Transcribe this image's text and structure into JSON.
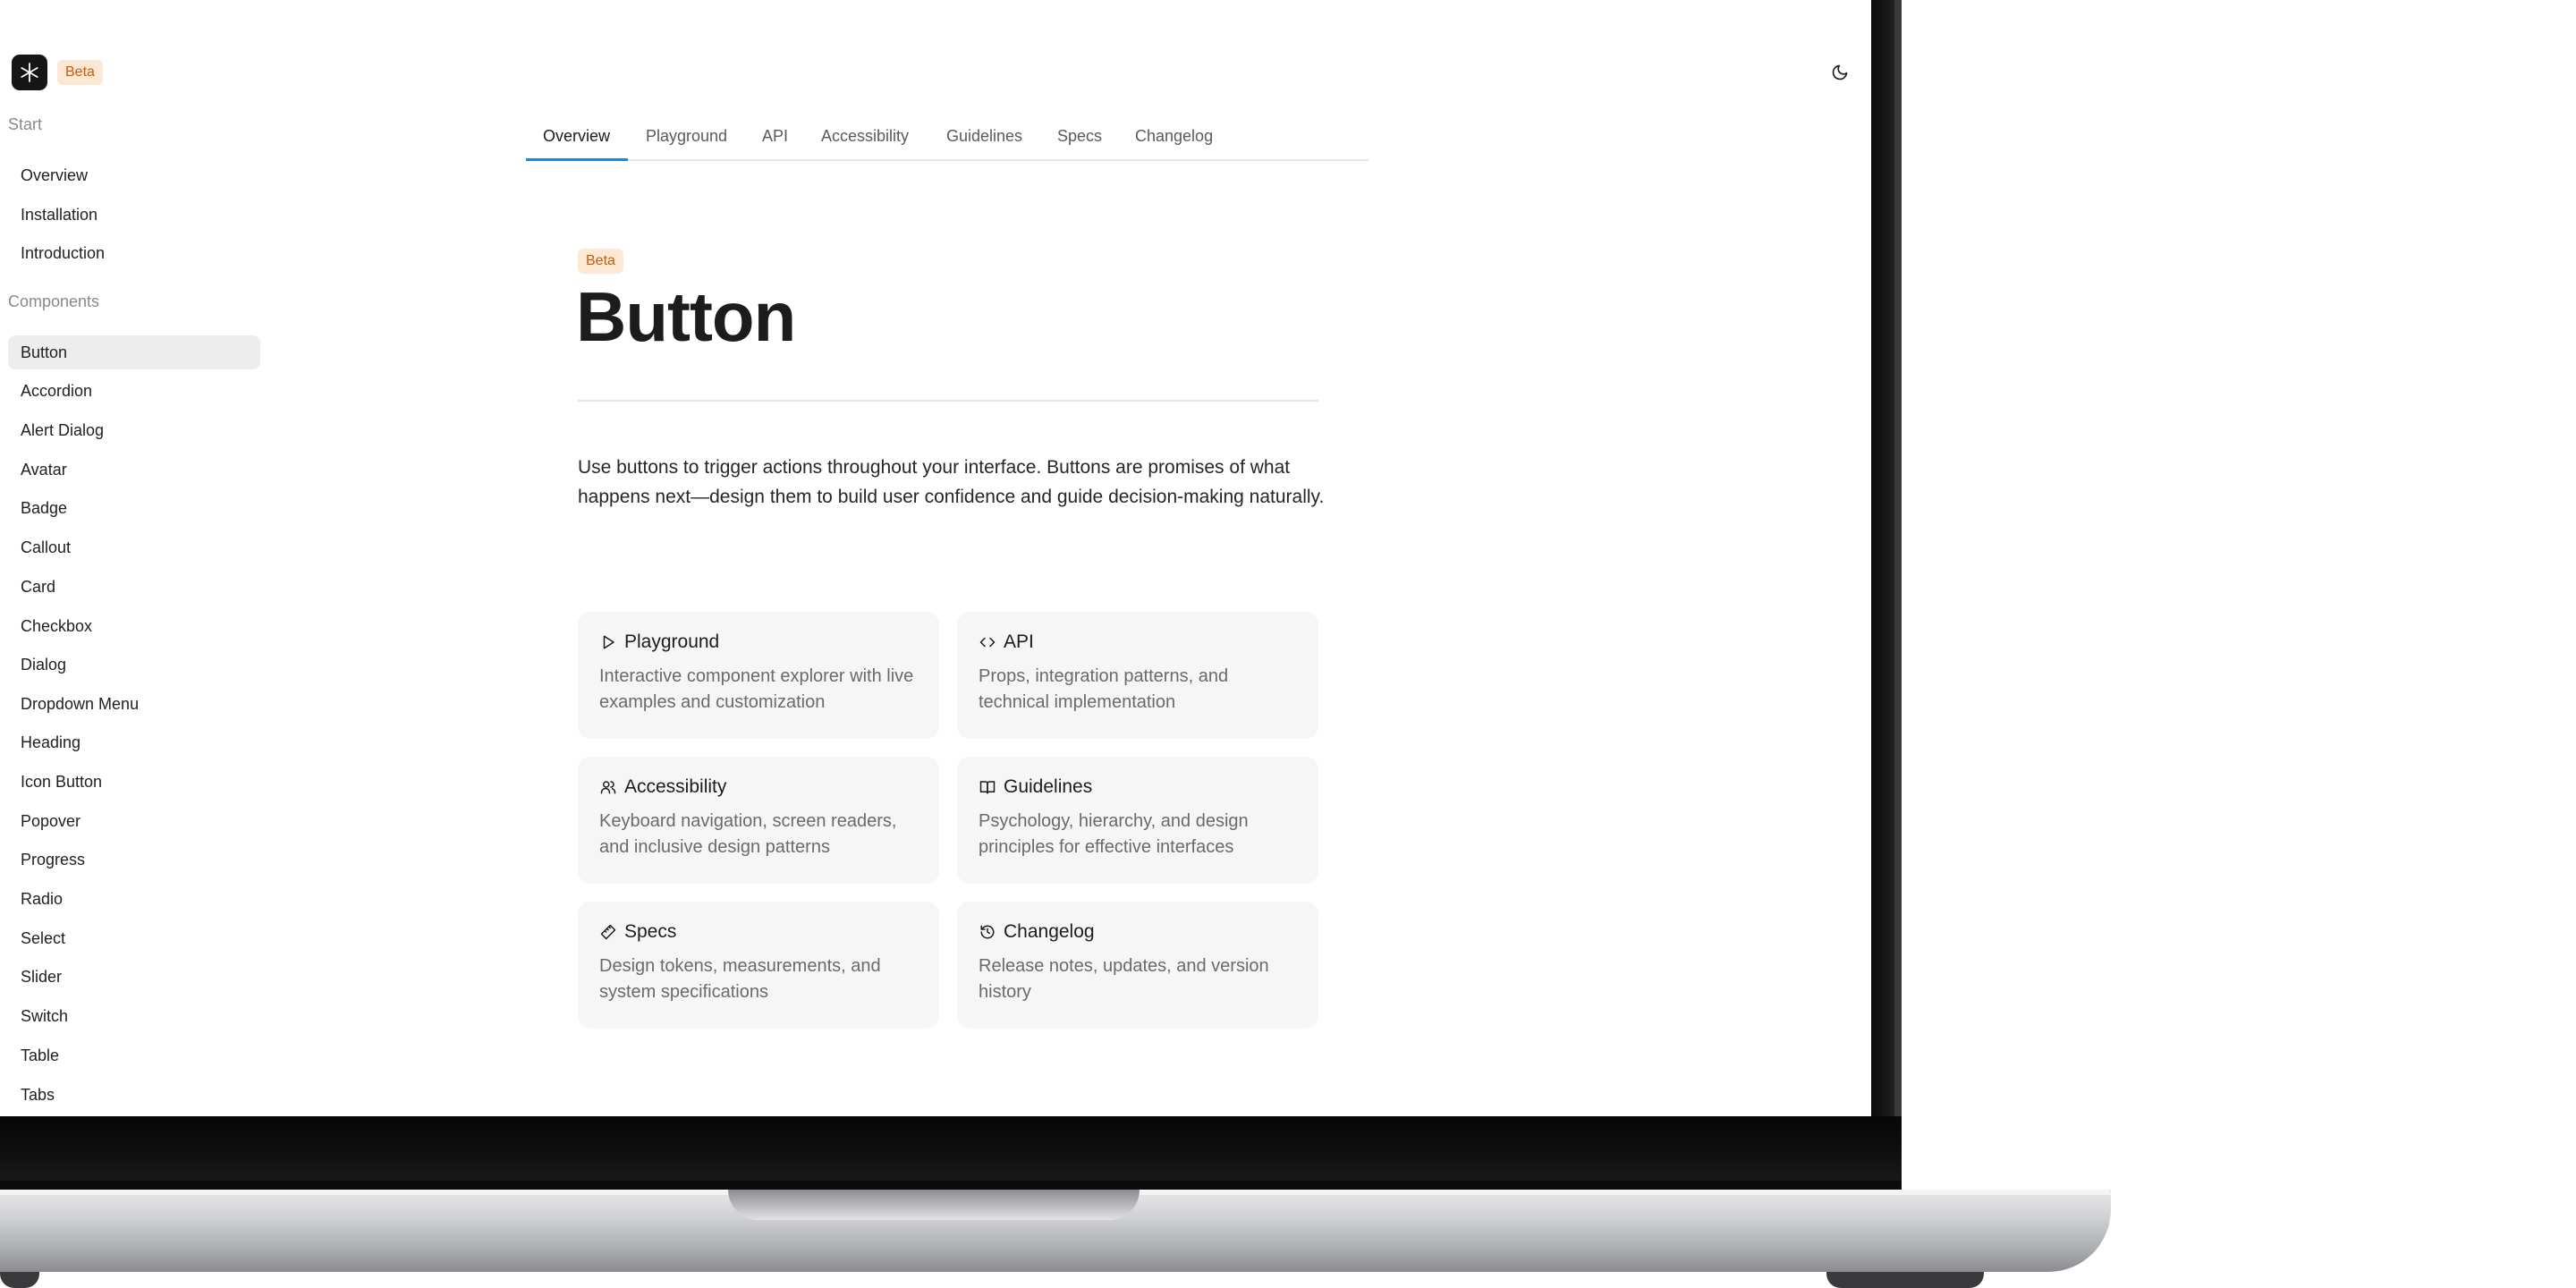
{
  "header": {
    "beta_badge": "Beta",
    "logo_icon": "asterisk-logo-icon",
    "theme_toggle_icon": "moon-icon"
  },
  "sidebar": {
    "sections": [
      {
        "label": "Start",
        "items": [
          {
            "label": "Overview",
            "active": false
          },
          {
            "label": "Installation",
            "active": false
          },
          {
            "label": "Introduction",
            "active": false
          }
        ]
      },
      {
        "label": "Components",
        "items": [
          {
            "label": "Button",
            "active": true
          },
          {
            "label": "Accordion",
            "active": false
          },
          {
            "label": "Alert Dialog",
            "active": false
          },
          {
            "label": "Avatar",
            "active": false
          },
          {
            "label": "Badge",
            "active": false
          },
          {
            "label": "Callout",
            "active": false
          },
          {
            "label": "Card",
            "active": false
          },
          {
            "label": "Checkbox",
            "active": false
          },
          {
            "label": "Dialog",
            "active": false
          },
          {
            "label": "Dropdown Menu",
            "active": false
          },
          {
            "label": "Heading",
            "active": false
          },
          {
            "label": "Icon Button",
            "active": false
          },
          {
            "label": "Popover",
            "active": false
          },
          {
            "label": "Progress",
            "active": false
          },
          {
            "label": "Radio",
            "active": false
          },
          {
            "label": "Select",
            "active": false
          },
          {
            "label": "Slider",
            "active": false
          },
          {
            "label": "Switch",
            "active": false
          },
          {
            "label": "Table",
            "active": false
          },
          {
            "label": "Tabs",
            "active": false
          }
        ]
      }
    ]
  },
  "tabs": [
    {
      "label": "Overview",
      "active": true
    },
    {
      "label": "Playground",
      "active": false
    },
    {
      "label": "API",
      "active": false
    },
    {
      "label": "Accessibility",
      "active": false
    },
    {
      "label": "Guidelines",
      "active": false
    },
    {
      "label": "Specs",
      "active": false
    },
    {
      "label": "Changelog",
      "active": false
    }
  ],
  "main": {
    "badge": "Beta",
    "title": "Button",
    "intro": "Use buttons to trigger actions throughout your interface. Buttons are promises of what happens next—design them to build user confidence and guide decision-making naturally.",
    "cards": [
      {
        "title": "Playground",
        "description": "Interactive component explorer with live examples and customization",
        "icon": "play-icon"
      },
      {
        "title": "API",
        "description": "Props, integration patterns, and technical implementation",
        "icon": "code-icon"
      },
      {
        "title": "Accessibility",
        "description": "Keyboard navigation, screen readers, and inclusive design patterns",
        "icon": "users-icon"
      },
      {
        "title": "Guidelines",
        "description": "Psychology, hierarchy, and design principles for effective interfaces",
        "icon": "book-open-icon"
      },
      {
        "title": "Specs",
        "description": "Design tokens, measurements, and system specifications",
        "icon": "ruler-icon"
      },
      {
        "title": "Changelog",
        "description": "Release notes, updates, and version history",
        "icon": "history-icon"
      }
    ]
  },
  "colors": {
    "accent": "#1c87d8",
    "beta_bg": "#fde8d3",
    "beta_text": "#c25b12",
    "card_bg": "#f6f6f6",
    "active_nav_bg": "#ededed"
  }
}
